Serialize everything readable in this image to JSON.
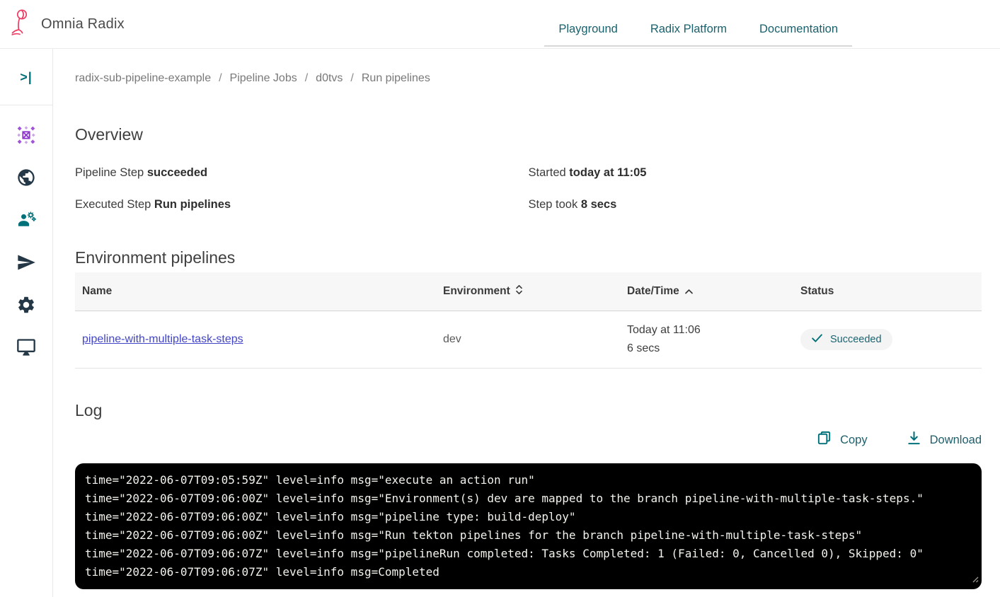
{
  "colors": {
    "accent_teal": "#007079",
    "nav_text": "#19616c",
    "brand_pink": "#ee3b63",
    "icon_dark": "#243746",
    "app_icon_purple": "#8d35cc",
    "link_blue": "#4245c8",
    "badge_bg": "#f4f4f4",
    "terminal_bg": "#000000"
  },
  "header": {
    "brand": "Omnia Radix",
    "nav": [
      {
        "label": "Playground"
      },
      {
        "label": "Radix Platform"
      },
      {
        "label": "Documentation"
      }
    ]
  },
  "sidebar": {
    "toggle": ">|",
    "icons": [
      {
        "name": "app-grid"
      },
      {
        "name": "globe"
      },
      {
        "name": "user-gear"
      },
      {
        "name": "send"
      },
      {
        "name": "gear"
      },
      {
        "name": "monitor"
      }
    ]
  },
  "breadcrumb": {
    "separator": "/",
    "items": [
      "radix-sub-pipeline-example",
      "Pipeline Jobs",
      "d0tvs",
      "Run pipelines"
    ]
  },
  "overview": {
    "title": "Overview",
    "fields": [
      {
        "label": "Pipeline Step",
        "value": "succeeded"
      },
      {
        "label": "Started",
        "value": "today at 11:05"
      },
      {
        "label": "Executed Step",
        "value": "Run pipelines"
      },
      {
        "label": "Step took",
        "value": "8 secs"
      }
    ]
  },
  "pipelines": {
    "title": "Environment pipelines",
    "columns": [
      {
        "label": "Name",
        "sort": "none"
      },
      {
        "label": "Environment",
        "sort": "both"
      },
      {
        "label": "Date/Time",
        "sort": "asc"
      },
      {
        "label": "Status",
        "sort": "none"
      }
    ],
    "rows": [
      {
        "name": "pipeline-with-multiple-task-steps",
        "environment": "dev",
        "date": "Today at 11:06",
        "duration": "6 secs",
        "status": "Succeeded"
      }
    ]
  },
  "log": {
    "title": "Log",
    "copy_label": "Copy",
    "download_label": "Download",
    "lines": [
      "time=\"2022-06-07T09:05:59Z\" level=info msg=\"execute an action run\"",
      "time=\"2022-06-07T09:06:00Z\" level=info msg=\"Environment(s) dev are mapped to the branch pipeline-with-multiple-task-steps.\"",
      "time=\"2022-06-07T09:06:00Z\" level=info msg=\"pipeline type: build-deploy\"",
      "time=\"2022-06-07T09:06:00Z\" level=info msg=\"Run tekton pipelines for the branch pipeline-with-multiple-task-steps\"",
      "time=\"2022-06-07T09:06:07Z\" level=info msg=\"pipelineRun completed: Tasks Completed: 1 (Failed: 0, Cancelled 0), Skipped: 0\"",
      "time=\"2022-06-07T09:06:07Z\" level=info msg=Completed"
    ]
  }
}
